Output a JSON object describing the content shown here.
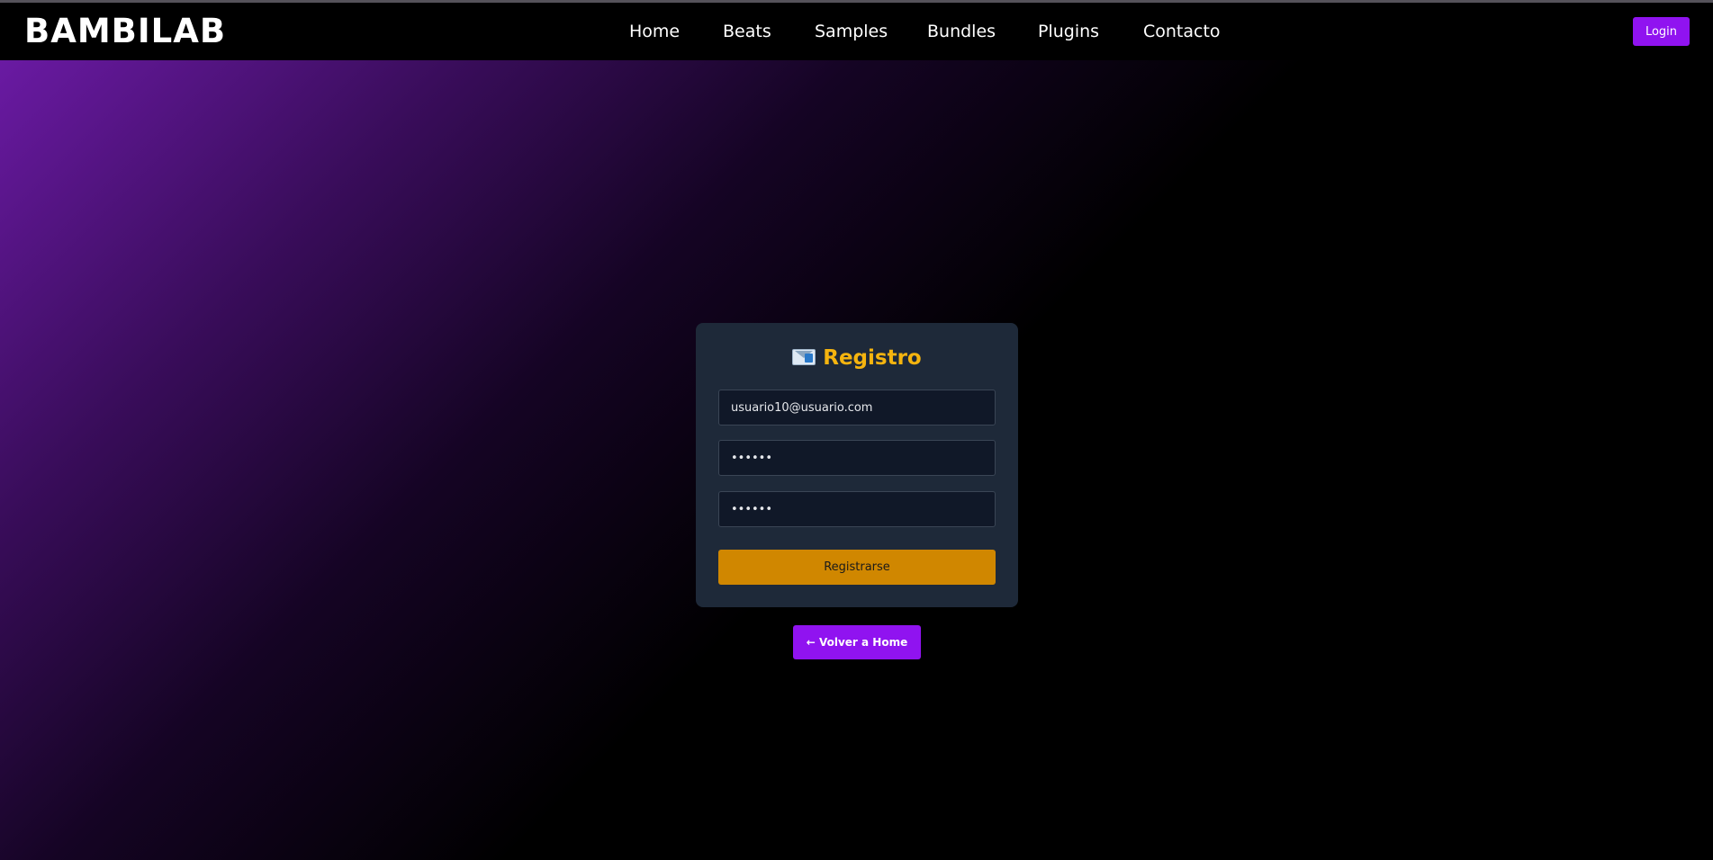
{
  "header": {
    "logo": "BAMBILAB",
    "nav": [
      "Home",
      "Beats",
      "Samples",
      "Bundles",
      "Plugins",
      "Contacto"
    ],
    "login_label": "Login"
  },
  "register": {
    "icon": "envelope-icon",
    "title": "Registro",
    "email_value": "usuario10@usuario.com",
    "password_value": "••••••",
    "confirm_value": "••••••",
    "submit_label": "Registrarse"
  },
  "back_home_label": "← Volver a Home",
  "colors": {
    "accent_purple": "#9013f0",
    "accent_amber": "#d08700",
    "title_yellow": "#f5b40f",
    "card_bg": "#1e2939"
  }
}
